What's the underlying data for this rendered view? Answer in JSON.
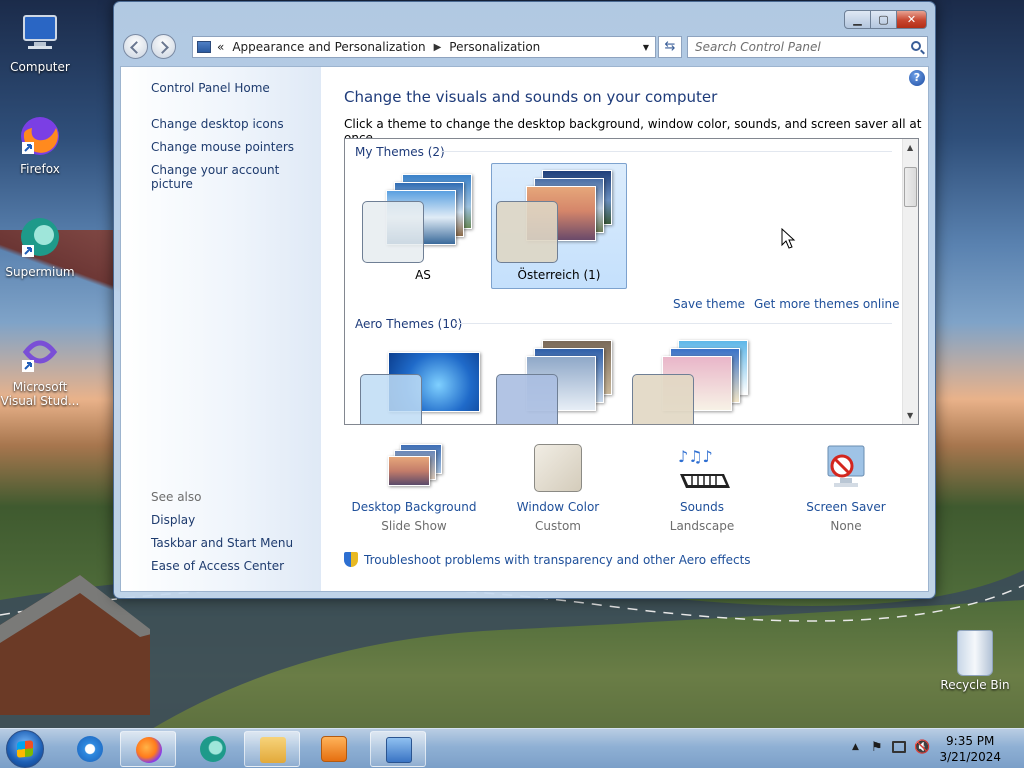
{
  "desktop": {
    "icons": [
      {
        "label": "Computer",
        "icon": "computer-icon"
      },
      {
        "label": "Firefox",
        "icon": "firefox-icon"
      },
      {
        "label": "Supermium",
        "icon": "supermium-icon"
      },
      {
        "label": "Microsoft Visual Stud...",
        "icon": "visual-studio-icon"
      }
    ],
    "recycle_bin": "Recycle Bin"
  },
  "window": {
    "address": {
      "crumb1": "Appearance and Personalization",
      "crumb2": "Personalization",
      "overflow": "«"
    },
    "search_placeholder": "Search Control Panel",
    "sidebar": {
      "home": "Control Panel Home",
      "links": [
        "Change desktop icons",
        "Change mouse pointers",
        "Change your account picture"
      ],
      "see_also_label": "See also",
      "see_also": [
        "Display",
        "Taskbar and Start Menu",
        "Ease of Access Center"
      ]
    },
    "main": {
      "title": "Change the visuals and sounds on your computer",
      "description": "Click a theme to change the desktop background, window color, sounds, and screen saver all at once.",
      "my_themes_header": "My Themes (2)",
      "my_themes": [
        {
          "name": "AS",
          "selected": false
        },
        {
          "name": "Österreich (1)",
          "selected": true
        }
      ],
      "save_theme": "Save theme",
      "get_more": "Get more themes online",
      "aero_themes_header": "Aero Themes (10)",
      "bottom": [
        {
          "label": "Desktop Background",
          "sub": "Slide Show",
          "icon": "desktop-background-icon"
        },
        {
          "label": "Window Color",
          "sub": "Custom",
          "icon": "window-color-icon"
        },
        {
          "label": "Sounds",
          "sub": "Landscape",
          "icon": "sounds-icon"
        },
        {
          "label": "Screen Saver",
          "sub": "None",
          "icon": "screen-saver-icon"
        }
      ],
      "troubleshoot": "Troubleshoot problems with transparency and other Aero effects"
    }
  },
  "taskbar": {
    "time": "9:35 PM",
    "date": "3/21/2024",
    "apps": [
      "internet-explorer-icon",
      "firefox-icon",
      "supermium-icon",
      "file-explorer-icon",
      "media-player-icon",
      "control-panel-icon"
    ]
  }
}
